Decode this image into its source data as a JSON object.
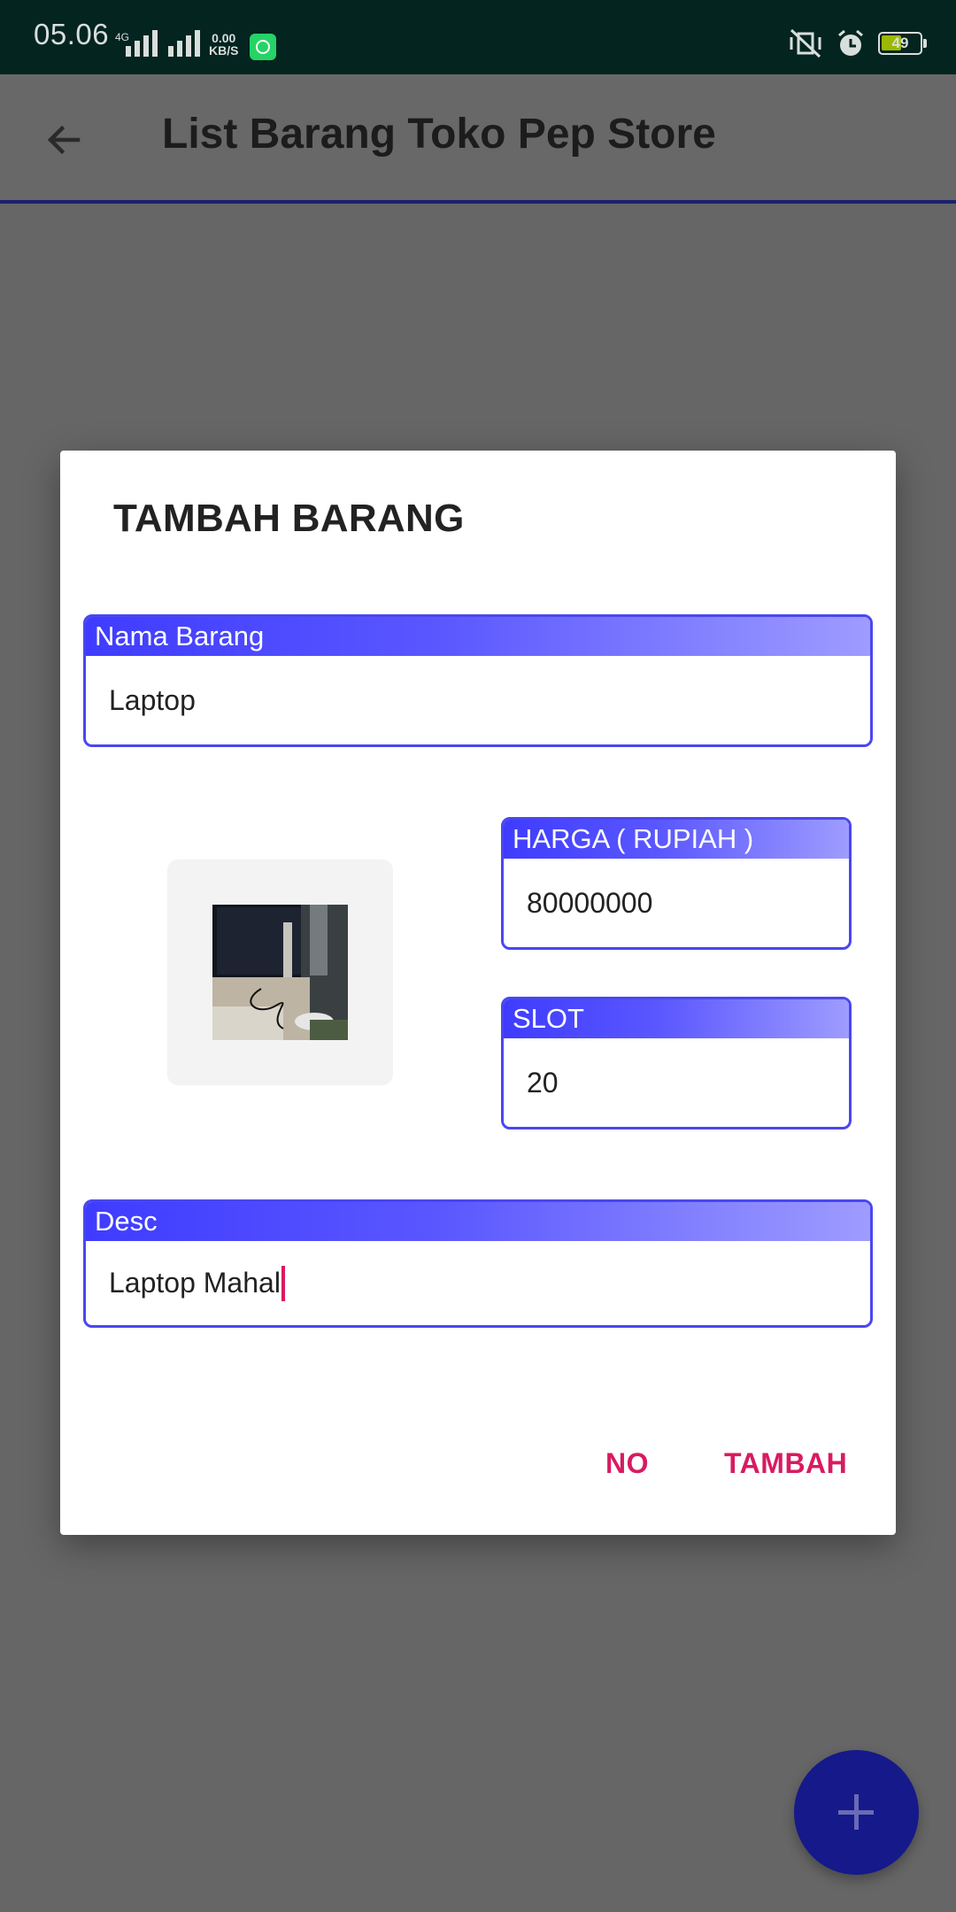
{
  "status_bar": {
    "time": "05.06",
    "network_type": "4G",
    "speed_value": "0.00",
    "speed_unit": "KB/S",
    "battery_level": "49",
    "icons": [
      "signal-icon",
      "signal-icon",
      "whatsapp-icon",
      "vibrate-off-icon",
      "alarm-icon",
      "battery-icon"
    ]
  },
  "app_bar": {
    "title": "List Barang Toko Pep Store",
    "back_icon": "arrow-back-icon"
  },
  "dialog": {
    "title": "TAMBAH BARANG",
    "fields": {
      "nama": {
        "label": "Nama Barang",
        "value": "Laptop"
      },
      "harga": {
        "label": "HARGA ( RUPIAH )",
        "value": "80000000"
      },
      "slot": {
        "label": "SLOT",
        "value": "20"
      },
      "desc": {
        "label": "Desc",
        "value": "Laptop Mahal"
      }
    },
    "image": {
      "icon": "product-photo"
    },
    "buttons": {
      "no": "NO",
      "tambah": "TAMBAH"
    }
  },
  "fab": {
    "icon": "plus-icon"
  },
  "colors": {
    "accent": "#4a47ef",
    "button_text": "#d81b60",
    "fab": "#15198a",
    "status_bar": "#03241f"
  }
}
